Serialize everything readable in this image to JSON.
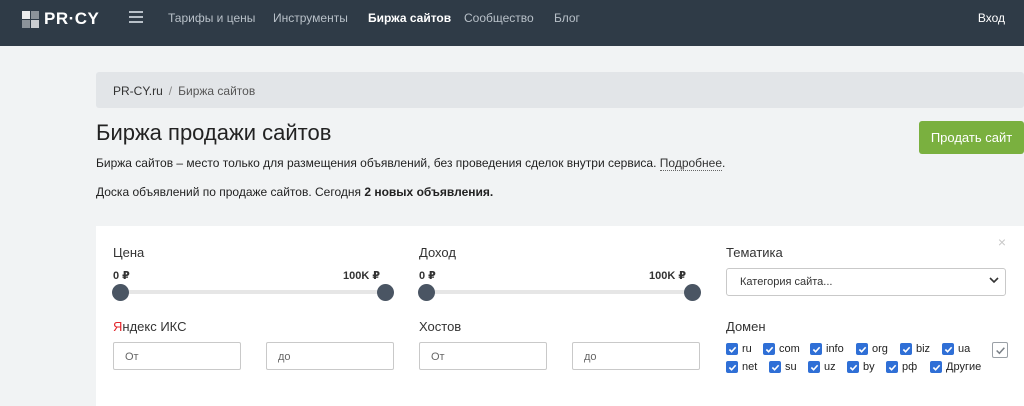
{
  "header": {
    "logo_text": "PR·CY",
    "nav": [
      {
        "label": "Тарифы и цены"
      },
      {
        "label": "Инструменты"
      },
      {
        "label": "Биржа сайтов",
        "active": true
      },
      {
        "label": "Сообщество"
      },
      {
        "label": "Блог"
      }
    ],
    "login_label": "Вход"
  },
  "breadcrumb": {
    "home": "PR-CY.ru",
    "separator": "/",
    "current": "Биржа сайтов"
  },
  "page": {
    "title": "Биржа продажи сайтов",
    "sell_button": "Продать сайт",
    "description": "Биржа сайтов – место только для размещения объявлений, без проведения сделок внутри сервиса.",
    "more_link": "Подробнее",
    "more_suffix": ".",
    "board_prefix": "Доска объявлений по продаже сайтов. Сегодня",
    "board_count": "2 новых объявления."
  },
  "filters": {
    "close_symbol": "×",
    "price": {
      "label": "Цена",
      "min_label": "0 ₽",
      "max_label": "100K ₽"
    },
    "income": {
      "label": "Доход",
      "min_label": "0 ₽",
      "max_label": "100K ₽"
    },
    "topic": {
      "label": "Тематика",
      "selected": "Категория сайта..."
    },
    "yandex": {
      "label_first": "Я",
      "label_rest": "ндекс ИКС",
      "from_placeholder": "От",
      "to_placeholder": "до"
    },
    "hosts": {
      "label": "Хостов",
      "from_placeholder": "От",
      "to_placeholder": "до"
    },
    "domain": {
      "label": "Домен",
      "row1": [
        "ru",
        "com",
        "info",
        "org",
        "biz",
        "ua"
      ],
      "row2": [
        "net",
        "su",
        "uz",
        "by",
        "рф",
        "Другие"
      ]
    }
  },
  "colors": {
    "navbar": "#2f3b47",
    "accent_green": "#7ab03f",
    "checkbox_blue": "#2f6fd6",
    "yandex_red": "#e3262b"
  }
}
